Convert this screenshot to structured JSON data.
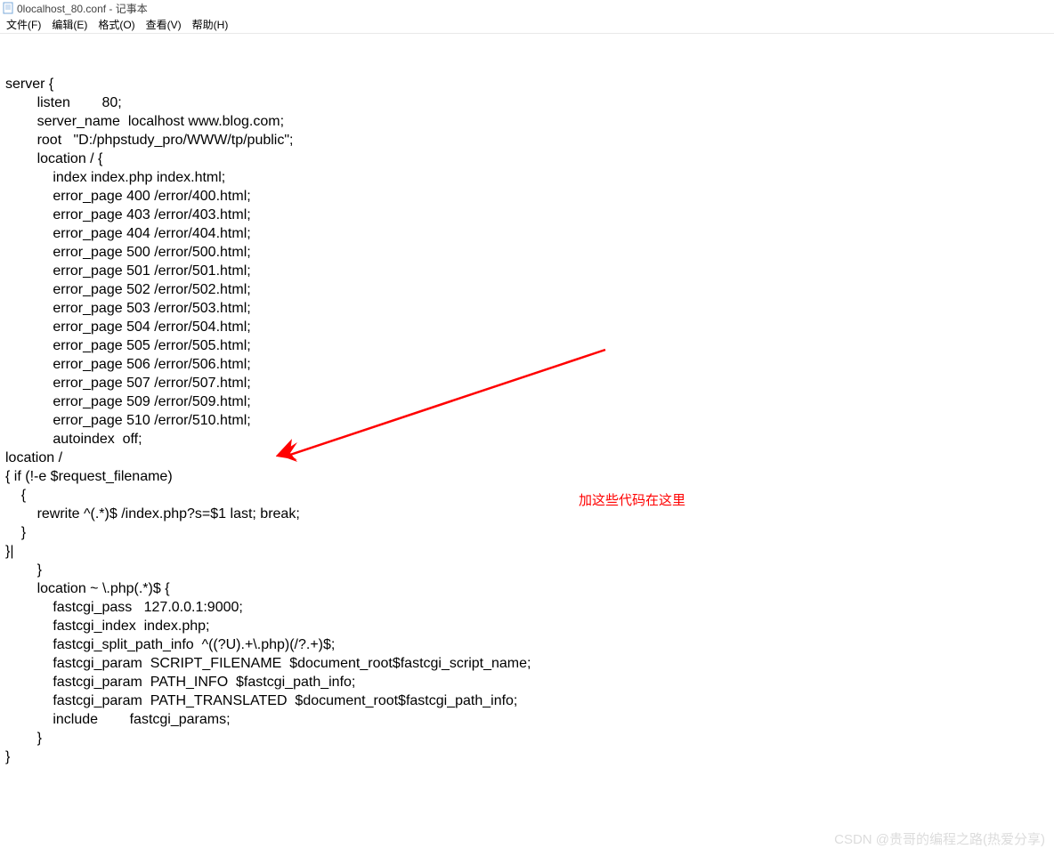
{
  "window": {
    "title": "0localhost_80.conf - 记事本"
  },
  "menu": {
    "file": "文件(F)",
    "edit": "编辑(E)",
    "format": "格式(O)",
    "view": "查看(V)",
    "help": "帮助(H)"
  },
  "editor": {
    "content": "server {\n        listen        80;\n        server_name  localhost www.blog.com;\n        root   \"D:/phpstudy_pro/WWW/tp/public\";\n        location / {\n            index index.php index.html;\n            error_page 400 /error/400.html;\n            error_page 403 /error/403.html;\n            error_page 404 /error/404.html;\n            error_page 500 /error/500.html;\n            error_page 501 /error/501.html;\n            error_page 502 /error/502.html;\n            error_page 503 /error/503.html;\n            error_page 504 /error/504.html;\n            error_page 505 /error/505.html;\n            error_page 506 /error/506.html;\n            error_page 507 /error/507.html;\n            error_page 509 /error/509.html;\n            error_page 510 /error/510.html;\n            autoindex  off;\nlocation /\n{ if (!-e $request_filename)\n    {\n        rewrite ^(.*)$ /index.php?s=$1 last; break;\n    }\n}|\n        }\n        location ~ \\.php(.*)$ {\n            fastcgi_pass   127.0.0.1:9000;\n            fastcgi_index  index.php;\n            fastcgi_split_path_info  ^((?U).+\\.php)(/?.+)$;\n            fastcgi_param  SCRIPT_FILENAME  $document_root$fastcgi_script_name;\n            fastcgi_param  PATH_INFO  $fastcgi_path_info;\n            fastcgi_param  PATH_TRANSLATED  $document_root$fastcgi_path_info;\n            include        fastcgi_params;\n        }\n}"
  },
  "annotation": {
    "text": "加这些代码在这里"
  },
  "watermark": {
    "text": "CSDN @贵哥的编程之路(热爱分享)"
  }
}
